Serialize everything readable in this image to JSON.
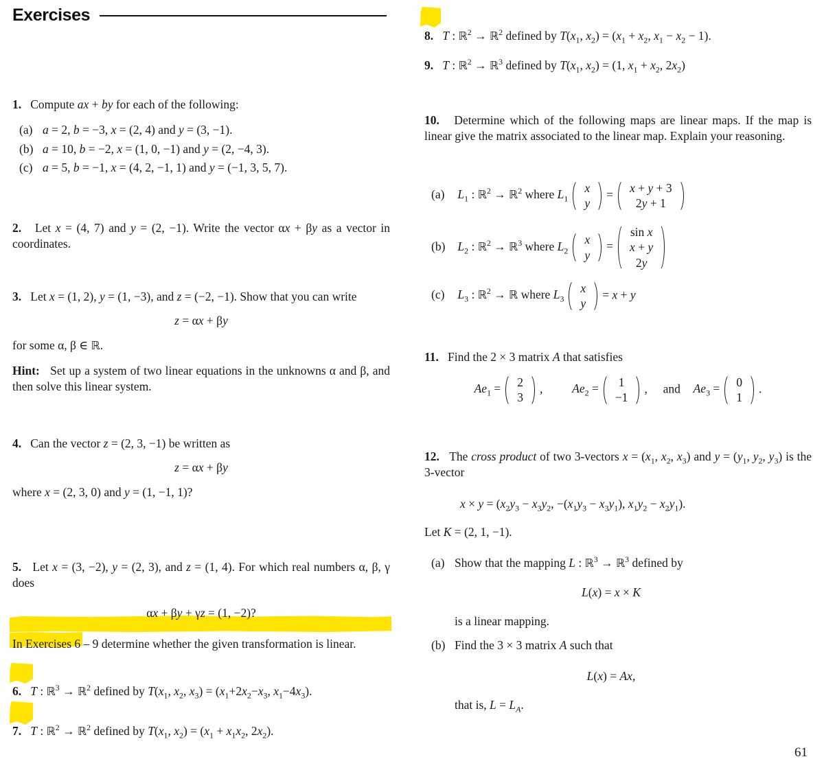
{
  "header": {
    "title": "Exercises"
  },
  "page_number": "61",
  "highlight_color": "#ffe400",
  "left_column": {
    "ex1": {
      "num": "1.",
      "stem": "Compute ax + by for each of the following:",
      "items": [
        {
          "tag": "(a)",
          "text": "a = 2, b = −3, x = (2, 4) and y = (3, −1)."
        },
        {
          "tag": "(b)",
          "text": "a = 10, b = −2, x = (1, 0, −1) and y = (2, −4, 3)."
        },
        {
          "tag": "(c)",
          "text": "a = 5, b = −1, x = (4, 2, −1, 1) and y = (−1, 3, 5, 7)."
        }
      ]
    },
    "ex2": {
      "num": "2.",
      "text": "Let x = (4, 7) and y = (2, −1). Write the vector αx + βy as a vector in coordinates."
    },
    "ex3": {
      "num": "3.",
      "text": "Let x = (1, 2), y = (1, −3), and z = (−2, −1). Show that you can write",
      "display": "z = αx + βy",
      "after": "for some α, β ∈ ℝ.",
      "hint_label": "Hint:",
      "hint_text": "Set up a system of two linear equations in the unknowns α and β, and then solve this linear system."
    },
    "ex4": {
      "num": "4.",
      "text": "Can the vector z = (2, 3, −1) be written as",
      "display": "z = αx + βy",
      "after": "where x = (2, 3, 0) and y = (1, −1, 1)?"
    },
    "ex5": {
      "num": "5.",
      "text": "Let x = (3, −2), y = (2, 3), and z = (1, 4). For which real numbers α, β, γ does",
      "display": "αx + βy + γz = (1, −2)?"
    },
    "instruction": {
      "text": "In Exercises 6 – 9 determine whether the given transformation is linear.",
      "highlighted": true
    },
    "ex6": {
      "num": "6.",
      "highlighted": true,
      "map": "T :",
      "domain": "3",
      "codomain": "2",
      "text": "defined by T(x1, x2, x3) = (x1+2x2−x3, x1−4x3)."
    },
    "ex7": {
      "num": "7.",
      "highlighted": true,
      "domain": "2",
      "codomain": "2",
      "text": "defined by T(x1, x2) = (x1 + x1x2, 2x2)."
    }
  },
  "right_column": {
    "ex8": {
      "num": "8.",
      "highlighted": true,
      "domain": "2",
      "codomain": "2",
      "text": "defined by T(x1, x2) = (x1 + x2, x1 − x2 − 1)."
    },
    "ex9": {
      "num": "9.",
      "domain": "2",
      "codomain": "3",
      "text": "defined by T(x1, x2) = (1, x1 + x2, 2x2)"
    },
    "ex10": {
      "num": "10.",
      "text": "Determine which of the following maps are linear maps. If the map is linear give the matrix associated to the linear map. Explain your reasoning.",
      "items": [
        {
          "tag": "(a)",
          "name": "L1",
          "sub": "1",
          "domain": "2",
          "codomain": "2",
          "where": "where",
          "input": [
            "x",
            "y"
          ],
          "output": [
            "x + y + 3",
            "2y + 1"
          ]
        },
        {
          "tag": "(b)",
          "name": "L2",
          "sub": "2",
          "domain": "2",
          "codomain": "3",
          "where": "where",
          "input": [
            "x",
            "y"
          ],
          "output": [
            "sin x",
            "x + y",
            "2y"
          ]
        },
        {
          "tag": "(c)",
          "name": "L3",
          "sub": "3",
          "domain": "2",
          "codomain": "",
          "where": "where",
          "input": [
            "x",
            "y"
          ],
          "output_inline": "= x + y"
        }
      ]
    },
    "ex11": {
      "num": "11.",
      "text": "Find the 2 × 3 matrix A that satisfies",
      "eq1_label": "Ae1",
      "eq1_vec": [
        "2",
        "3"
      ],
      "eq2_label": "Ae2",
      "eq2_vec": [
        "1",
        "−1"
      ],
      "conj": "and",
      "eq3_label": "Ae3",
      "eq3_vec": [
        "0",
        "1"
      ],
      "comma": ",",
      "period": "."
    },
    "ex12": {
      "num": "12.",
      "lead_1": "The",
      "emph": "cross product",
      "lead_2": "of two 3-vectors x = (x1, x2, x3) and y = (y1, y2, y3) is the 3-vector",
      "display": "x × y = (x2y3 − x3y2, −(x1y3 − x3y1), x1y2 − x2y1).",
      "let_k": "Let K = (2, 1, −1).",
      "items": [
        {
          "tag": "(a)",
          "text": "Show that the mapping L :",
          "domain": "3",
          "codomain": "3",
          "text_tail": "defined by",
          "display": "L(x) = x × K",
          "after": "is a linear mapping."
        },
        {
          "tag": "(b)",
          "text": "Find the 3 × 3 matrix A such that",
          "display": "L(x) = Ax,",
          "after": "that is, L = LA."
        }
      ]
    }
  }
}
